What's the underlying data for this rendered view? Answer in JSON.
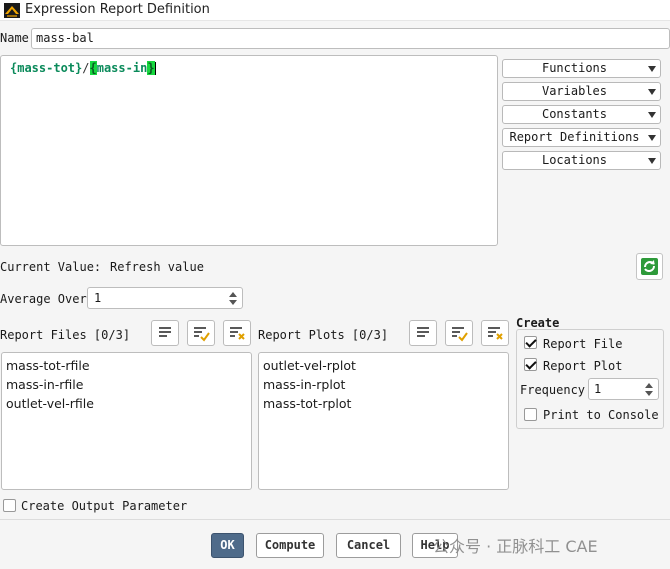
{
  "window": {
    "title": "Expression Report Definition"
  },
  "name": {
    "label": "Name",
    "value": "mass-bal"
  },
  "expression": {
    "brace_open_1": "{",
    "term1": "mass-tot",
    "brace_close_1": "}",
    "operator": "/",
    "brace_open_2": "{",
    "term2": "mass-in",
    "brace_close_2": "}"
  },
  "menus": [
    {
      "label": "Functions"
    },
    {
      "label": "Variables"
    },
    {
      "label": "Constants"
    },
    {
      "label": "Report Definitions"
    },
    {
      "label": "Locations"
    }
  ],
  "current_value": {
    "label": "Current Value:",
    "value": "Refresh value"
  },
  "average_over": {
    "label": "Average Over",
    "value": "1"
  },
  "report_files": {
    "label": "Report Files [0/3]",
    "items": [
      "mass-tot-rfile",
      "mass-in-rfile",
      "outlet-vel-rfile"
    ]
  },
  "report_plots": {
    "label": "Report Plots [0/3]",
    "items": [
      "outlet-vel-rplot",
      "mass-in-rplot",
      "mass-tot-rplot"
    ]
  },
  "create": {
    "heading": "Create",
    "report_file": {
      "label": "Report File",
      "checked": true
    },
    "report_plot": {
      "label": "Report Plot",
      "checked": true
    },
    "frequency_label": "Frequency",
    "frequency_value": "1",
    "print_console": {
      "label": "Print to Console",
      "checked": false
    }
  },
  "output_param": {
    "label": "Create Output Parameter",
    "checked": false
  },
  "buttons": {
    "ok": "OK",
    "compute": "Compute",
    "cancel": "Cancel",
    "help": "Help"
  },
  "watermark": "公众号 · 正脉科工 CAE",
  "colors": {
    "accent": "#4f6b8a",
    "highlight": "#17d83f",
    "token": "#0a8a5a"
  }
}
